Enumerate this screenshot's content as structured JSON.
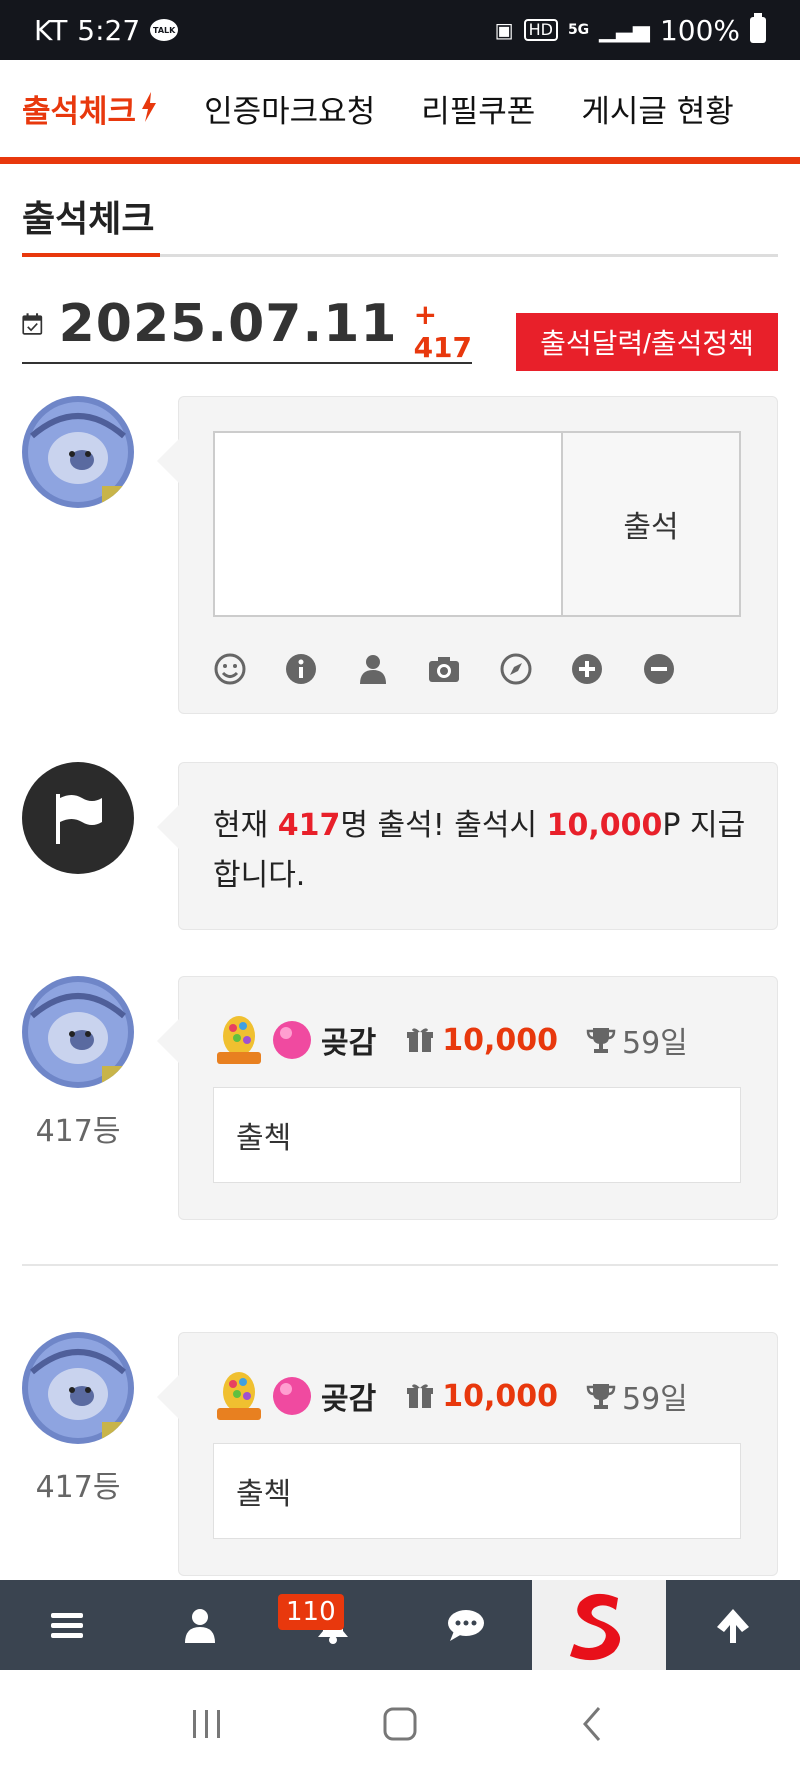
{
  "status_bar": {
    "carrier": "KT",
    "time": "5:27",
    "talk_badge": "TALK",
    "hd_label": "HD",
    "net_label": "5G",
    "battery": "100%"
  },
  "topnav": {
    "tabs": [
      {
        "label": "출석체크",
        "active": true
      },
      {
        "label": "인증마크요청"
      },
      {
        "label": "리필쿠폰"
      },
      {
        "label": "게시글 현황"
      }
    ]
  },
  "section": {
    "title": "출석체크",
    "date": "2025.07.11",
    "count": "+ 417",
    "policy_button": "출석달력/출석정책"
  },
  "compose": {
    "submit_label": "출석",
    "text": "",
    "tools": [
      "smile-icon",
      "info-icon",
      "user-icon",
      "camera-icon",
      "compass-icon",
      "plus-circle-icon",
      "minus-circle-icon"
    ]
  },
  "notice": {
    "prefix": "현재 ",
    "count": "417",
    "middle": "명 출석! 출석시 ",
    "points": "10,000",
    "suffix": "P 지급합니다."
  },
  "entries": [
    {
      "nick": "곶감",
      "points": "10,000",
      "days": "59일",
      "rank": "417등",
      "message": "출첵"
    },
    {
      "nick": "곶감",
      "points": "10,000",
      "days": "59일",
      "rank": "417등",
      "message": "출첵"
    }
  ],
  "bottom_bar": {
    "notification_count": "110",
    "items": [
      "menu-icon",
      "user-icon",
      "bell-icon",
      "chat-icon",
      "site-logo",
      "arrow-up-icon"
    ]
  },
  "colors": {
    "accent": "#e8380d",
    "highlight": "#e8202a",
    "bottom_bar": "#3a4450"
  }
}
